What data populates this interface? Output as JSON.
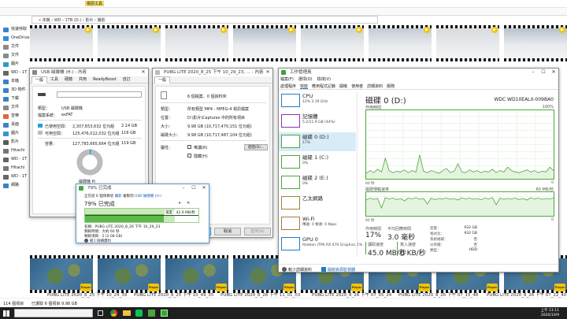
{
  "explorer": {
    "ribbon_context_tab": "視訊工具",
    "address_path": "« 本機 › WD - 1TB (D:) › 影片 › 撮影",
    "nav_items": [
      "快速存取",
      "OneDrive",
      "文件",
      "文件",
      "圖片",
      "WD - 1T",
      "本機",
      "3D 物件",
      "下載",
      "文件",
      "音樂",
      "桌面",
      "圖片",
      "影片",
      "Hitachi",
      "WD - 1T",
      "Hitachi",
      "WD - 1T",
      "網路"
    ],
    "status_left": "114 個項目",
    "status_selected": "已選取 6 個項目 9.98 GB",
    "thumb_captions": [
      "PUBG LITE 2020_8_25 下午 10_24_39",
      "PUBG LITE 2020_8_25 下午 10_49_35",
      "PUBG LITE 2020_8_26 下午 11_01_03",
      "PUBG LITE 2020_8_26 下午 07_05_24",
      "PUBG LITE 2020_8_26 下午 07_15_48",
      "PUBG LITE 2020_8_26 下午 07_22_40"
    ],
    "player_label": "Player"
  },
  "usb_props": {
    "title": "USB 磁碟機 (H:) - 內容",
    "tabs": [
      "一般",
      "工具",
      "硬體",
      "共用",
      "ReadyBoost",
      "自訂"
    ],
    "drive_type_label": "類型：",
    "drive_type": "USB 磁碟機",
    "fs_label": "檔案系統：",
    "fs": "exFAT",
    "used_label": "已使用空間：",
    "used_bytes": "2,307,653,632 位元組",
    "used_gb": "2.14 GB",
    "free_label": "可用空間：",
    "free_bytes": "125,476,012,032 位元組",
    "free_gb": "116 GB",
    "capacity_label": "容量：",
    "capacity_bytes": "127,783,665,664 位元組",
    "capacity_gb": "119 GB",
    "drive_label": "磁碟機 H:",
    "used_fraction": 0.018
  },
  "file_props": {
    "title": "PUBG LITE 2020_8_25 下午 10_29_23, ... - 內容",
    "tab": "一般",
    "files_summary": "6 個檔案、0 個資料夾",
    "type_label": "類型：",
    "type_value": "所有類型 MP4 - MPEG-4 視訊檔案",
    "location_label": "位置：",
    "location_value": "D:\\影片\\Captures 中的所有項目",
    "size_label": "大小：",
    "size_value": "9.98 GB (10,717,470,151 位元組)",
    "disk_size_label": "磁碟大小：",
    "disk_size_value": "9.98 GB (10,717,487,104 位元組)",
    "attr_label": "屬性：",
    "readonly_label": "唯讀(R)",
    "hidden_label": "隱藏(H)",
    "advanced_button": "進階(D)...",
    "ok_button": "確定",
    "cancel_button": "取消",
    "apply_button": "套用(A)"
  },
  "copy_dialog": {
    "title": "79% 已完成",
    "line1_prefix": "正在從 6 個項目從 ",
    "line1_src": "攝影",
    "line1_mid": " 複製到 ",
    "line1_dst": "USB 磁碟機 (H:)",
    "progress_text": "79% 已完成",
    "speed_text": "速度：42.9 MB/秒",
    "progress": 0.79,
    "name_label": "名稱：PUBG LITE 2020_8_26 下午 10_29_23",
    "time_left": "剩餘時間：大約 60 秒",
    "items_left": "剩餘項目：2 (2.08 GB)",
    "less_details": "較少詳細資料"
  },
  "taskmgr": {
    "title": "工作管理員",
    "menu": [
      "檔案(F)",
      "選項(O)",
      "檢視(V)"
    ],
    "tabs": [
      "處理程序",
      "效能",
      "應用程式記錄",
      "開機",
      "使用者",
      "詳細資料",
      "服務"
    ],
    "resources": [
      {
        "name": "CPU",
        "detail": "12% 3.19 GHz",
        "color": "#1a7fc6"
      },
      {
        "name": "記憶體",
        "detail": "5.2/11.9 GB (44%)",
        "color": "#8b31b5"
      },
      {
        "name": "磁碟 0 (D:)",
        "detail": "17%",
        "color": "#4aa83b"
      },
      {
        "name": "磁碟 1 (C:)",
        "detail": "0%",
        "color": "#4aa83b"
      },
      {
        "name": "磁碟 2 (E:)",
        "detail": "0%",
        "color": "#4aa83b"
      },
      {
        "name": "乙太網路",
        "detail": "",
        "color": "#a87d3b"
      },
      {
        "name": "Wi-Fi",
        "detail": "傳送: 0 接收: 0 Kbps",
        "color": "#a87d3b"
      },
      {
        "name": "GPU 0",
        "detail": "Radeon (TM) RX 470 Graphics 1%",
        "color": "#1a7fc6"
      }
    ],
    "disk_title": "磁碟 0 (D:)",
    "disk_model": "WDC WD10EALX-009BA0",
    "active_time_label": "作用時間",
    "percent_max": "100%",
    "axis_left": "60 秒",
    "axis_right": "0",
    "transfer_label": "磁碟傳輸速率",
    "transfer_max": "60 MB/秒",
    "active_label": "作用時間",
    "active_value": "17%",
    "resp_label": "平均回應時間",
    "resp_value": "3.0 毫秒",
    "read_label": "讀取速度",
    "read_value": "45.0 MB/秒",
    "write_label": "寫入速度",
    "write_value": "0 KB/秒",
    "capacity_label": "容量：",
    "capacity_value": "932 GB",
    "formatted_label": "格式化：",
    "formatted_value": "932 GB",
    "system_label": "系統磁碟：",
    "system_value": "否",
    "pagefile_label": "分頁檔：",
    "pagefile_value": "否",
    "type_label": "類型：",
    "type_value": "HDD",
    "less_details": "較少詳細資料",
    "open_monitor": "開啟資源監視器",
    "active_series": [
      8,
      12,
      9,
      14,
      10,
      30,
      12,
      9,
      11,
      10,
      13,
      9,
      12,
      10,
      35,
      11,
      9,
      12,
      10,
      8,
      12,
      15,
      9,
      11,
      22,
      10,
      9,
      13,
      10,
      12,
      9,
      11,
      10,
      14,
      9,
      12,
      10,
      17,
      12,
      10,
      9,
      11,
      13,
      10,
      12,
      9,
      11,
      10,
      17,
      12
    ],
    "transfer_series": [
      40,
      45,
      42,
      44,
      20,
      46,
      43,
      45,
      41,
      44,
      38,
      45,
      43,
      46,
      42,
      44,
      30,
      45,
      41,
      44,
      43,
      45,
      42,
      44,
      40,
      46,
      43,
      45,
      42,
      44,
      41,
      45,
      43,
      46,
      28,
      45,
      42,
      44,
      43,
      45,
      41,
      44,
      40,
      46,
      43,
      45,
      42,
      44,
      43,
      45
    ]
  },
  "taskbar": {
    "time": "上午 11:11",
    "date": "2020/10/9"
  }
}
